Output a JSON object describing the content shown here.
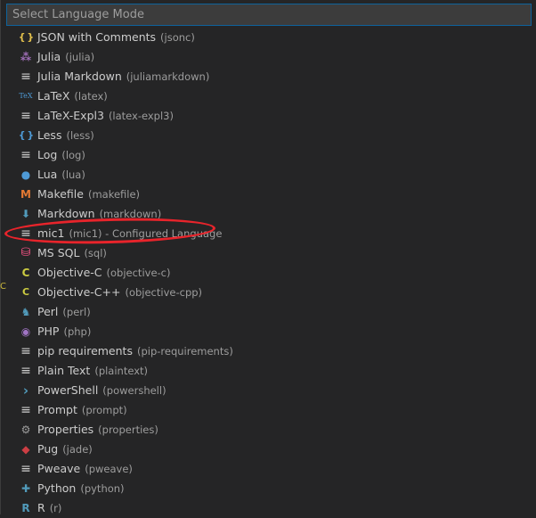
{
  "search": {
    "placeholder": "Select Language Mode"
  },
  "items": [
    {
      "label": "JSON with Comments",
      "desc": "(jsonc)",
      "icon": "braces-icon",
      "color": "#e2c04c"
    },
    {
      "label": "Julia",
      "desc": "(julia)",
      "icon": "julia-icon",
      "color": "#a270ba"
    },
    {
      "label": "Julia Markdown",
      "desc": "(juliamarkdown)",
      "icon": "lines-icon",
      "color": "#cccccc"
    },
    {
      "label": "LaTeX",
      "desc": "(latex)",
      "icon": "tex-icon",
      "color": "#4e9ad6"
    },
    {
      "label": "LaTeX-Expl3",
      "desc": "(latex-expl3)",
      "icon": "lines-icon",
      "color": "#cccccc"
    },
    {
      "label": "Less",
      "desc": "(less)",
      "icon": "braces-icon",
      "color": "#4e9ad6"
    },
    {
      "label": "Log",
      "desc": "(log)",
      "icon": "lines-icon",
      "color": "#cccccc"
    },
    {
      "label": "Lua",
      "desc": "(lua)",
      "icon": "lua-icon",
      "color": "#4e9ad6"
    },
    {
      "label": "Makefile",
      "desc": "(makefile)",
      "icon": "makefile-icon",
      "color": "#e37933"
    },
    {
      "label": "Markdown",
      "desc": "(markdown)",
      "icon": "markdown-icon",
      "color": "#519aba"
    },
    {
      "label": "mic1",
      "desc": "(mic1) - Configured Language",
      "icon": "lines-icon",
      "color": "#cccccc"
    },
    {
      "label": "MS SQL",
      "desc": "(sql)",
      "icon": "database-icon",
      "color": "#f55385"
    },
    {
      "label": "Objective-C",
      "desc": "(objective-c)",
      "icon": "objc-icon",
      "color": "#cbcb41"
    },
    {
      "label": "Objective-C++",
      "desc": "(objective-cpp)",
      "icon": "objcpp-icon",
      "color": "#cbcb41"
    },
    {
      "label": "Perl",
      "desc": "(perl)",
      "icon": "camel-icon",
      "color": "#519aba"
    },
    {
      "label": "PHP",
      "desc": "(php)",
      "icon": "elephant-icon",
      "color": "#a074c4"
    },
    {
      "label": "pip requirements",
      "desc": "(pip-requirements)",
      "icon": "lines-icon",
      "color": "#cccccc"
    },
    {
      "label": "Plain Text",
      "desc": "(plaintext)",
      "icon": "lines-icon",
      "color": "#cccccc"
    },
    {
      "label": "PowerShell",
      "desc": "(powershell)",
      "icon": "terminal-icon",
      "color": "#519aba"
    },
    {
      "label": "Prompt",
      "desc": "(prompt)",
      "icon": "lines-icon",
      "color": "#cccccc"
    },
    {
      "label": "Properties",
      "desc": "(properties)",
      "icon": "gear-icon",
      "color": "#9d9d9d"
    },
    {
      "label": "Pug",
      "desc": "(jade)",
      "icon": "pug-icon",
      "color": "#cc3e44"
    },
    {
      "label": "Pweave",
      "desc": "(pweave)",
      "icon": "lines-icon",
      "color": "#cccccc"
    },
    {
      "label": "Python",
      "desc": "(python)",
      "icon": "python-icon",
      "color": "#519aba"
    },
    {
      "label": "R",
      "desc": "(r)",
      "icon": "r-icon",
      "color": "#519aba"
    }
  ]
}
